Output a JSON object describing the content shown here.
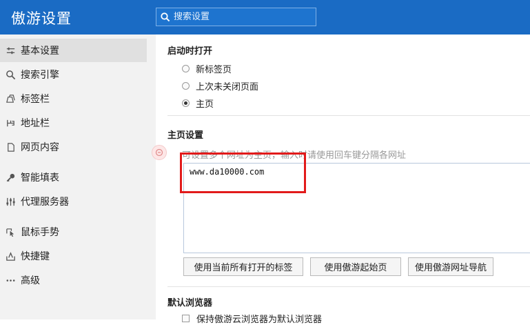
{
  "header": {
    "title": "傲游设置",
    "search_placeholder": "搜索设置"
  },
  "sidebar": {
    "items": [
      {
        "label": "基本设置",
        "icon": "sliders-icon",
        "active": true
      },
      {
        "label": "搜索引擎",
        "icon": "search-icon",
        "active": false
      },
      {
        "label": "标签栏",
        "icon": "tabs-icon",
        "active": false
      },
      {
        "label": "地址栏",
        "icon": "address-bar-icon",
        "active": false
      },
      {
        "label": "网页内容",
        "icon": "page-icon",
        "active": false
      },
      {
        "label": "智能填表",
        "icon": "key-icon",
        "active": false
      },
      {
        "label": "代理服务器",
        "icon": "proxy-icon",
        "active": false
      },
      {
        "label": "鼠标手势",
        "icon": "cursor-icon",
        "active": false
      },
      {
        "label": "快捷键",
        "icon": "shortcut-icon",
        "active": false
      },
      {
        "label": "高级",
        "icon": "more-icon",
        "active": false
      }
    ]
  },
  "startup": {
    "title": "启动时打开",
    "options": [
      {
        "label": "新标签页",
        "checked": false
      },
      {
        "label": "上次未关闭页面",
        "checked": false
      },
      {
        "label": "主页",
        "checked": true
      }
    ]
  },
  "homepage": {
    "title": "主页设置",
    "hint": "可设置多个网址为主页，输入时请使用回车键分隔各网址",
    "value": "www.da10000.com",
    "buttons": [
      "使用当前所有打开的标签",
      "使用傲游起始页",
      "使用傲游网址导航"
    ]
  },
  "default_browser": {
    "title": "默认浏览器",
    "checkbox_label": "保持傲游云浏览器为默认浏览器"
  },
  "colors": {
    "header": "#1a6bc4",
    "sidebar": "#f2f2f2",
    "highlight": "#e21a1a"
  }
}
